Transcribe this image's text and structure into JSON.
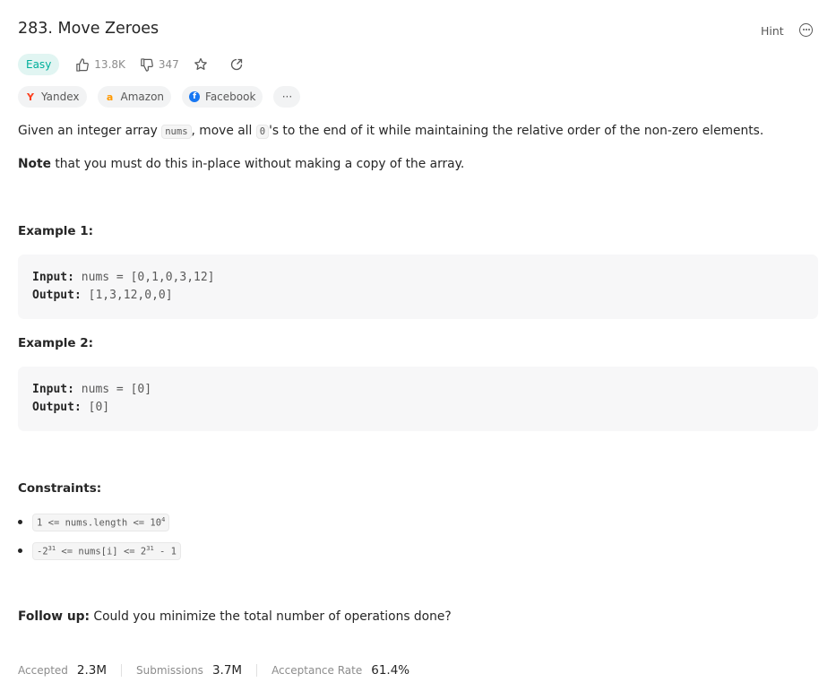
{
  "problem": {
    "title": "283. Move Zeroes",
    "hint_label": "Hint",
    "difficulty": "Easy",
    "likes": "13.8K",
    "dislikes": "347"
  },
  "companies": [
    {
      "name": "Yandex",
      "logo": "Y",
      "color": "#fc3f1d"
    },
    {
      "name": "Amazon",
      "logo": "a",
      "color": "#ff9900"
    },
    {
      "name": "Facebook",
      "logo": "f",
      "color": "#1877f2"
    }
  ],
  "more_tags_label": "···",
  "description": {
    "p1_a": "Given an integer array ",
    "p1_code1": "nums",
    "p1_b": ", move all ",
    "p1_code2": "0",
    "p1_c": "'s to the end of it while maintaining the relative order of the non-zero elements.",
    "p2_bold": "Note",
    "p2_rest": " that you must do this in-place without making a copy of the array."
  },
  "examples": [
    {
      "title": "Example 1:",
      "input_label": "Input:",
      "input": "nums = [0,1,0,3,12]",
      "output_label": "Output:",
      "output": "[1,3,12,0,0]"
    },
    {
      "title": "Example 2:",
      "input_label": "Input:",
      "input": "nums = [0]",
      "output_label": "Output:",
      "output": "[0]"
    }
  ],
  "constraints": {
    "title": "Constraints:",
    "c1_a": "1 <= nums.length <= 10",
    "c1_sup": "4",
    "c2_a": "-2",
    "c2_sup1": "31",
    "c2_b": " <= nums[i] <= 2",
    "c2_sup2": "31",
    "c2_c": " - 1"
  },
  "followup": {
    "bold": "Follow up:",
    "text": " Could you minimize the total number of operations done?"
  },
  "stats": {
    "accepted_label": "Accepted",
    "accepted": "2.3M",
    "submissions_label": "Submissions",
    "submissions": "3.7M",
    "rate_label": "Acceptance Rate",
    "rate": "61.4%"
  }
}
